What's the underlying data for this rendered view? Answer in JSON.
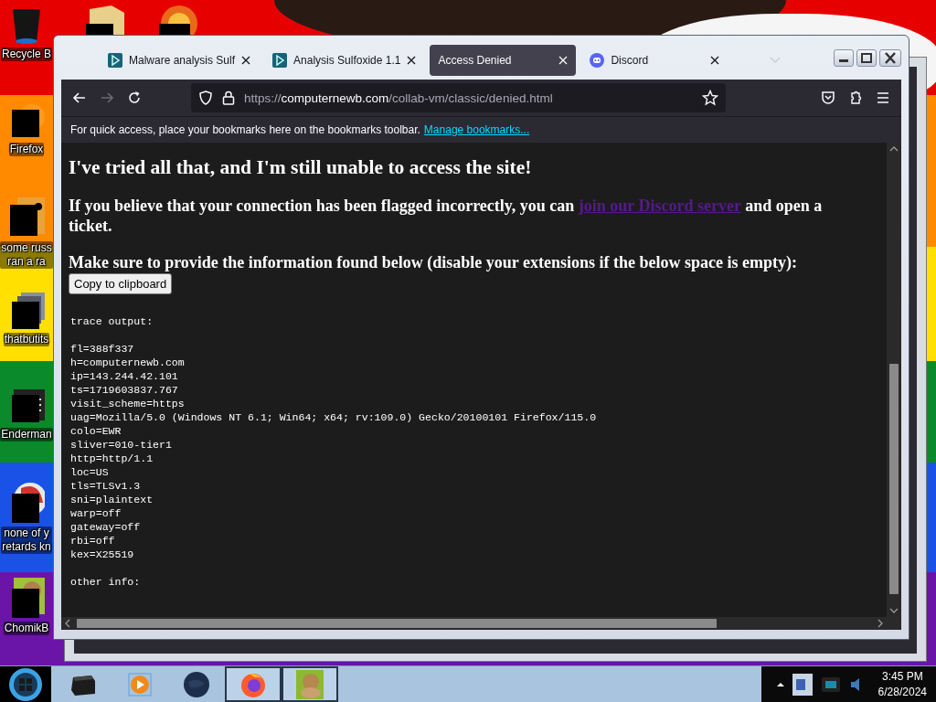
{
  "desktop": {
    "icons": [
      {
        "kind": "bin",
        "label_lines": [
          "Recycle B"
        ]
      },
      {
        "kind": "firefox",
        "label_lines": [
          "Firefox"
        ]
      },
      {
        "kind": "document",
        "label_lines": [
          "some russ",
          "ran a ra"
        ]
      },
      {
        "kind": "windows",
        "label_lines": [
          "thatbutits"
        ]
      },
      {
        "kind": "terminal",
        "label_lines": [
          "Enderman"
        ]
      },
      {
        "kind": "browser",
        "label_lines": [
          "none of y",
          "retards kn"
        ]
      },
      {
        "kind": "hamster",
        "label_lines": [
          "ChomikB"
        ]
      }
    ]
  },
  "browser": {
    "tabs": [
      {
        "title": "Malware analysis Sulf",
        "kind": "video",
        "selected": false
      },
      {
        "title": "Analysis Sulfoxide 1.1",
        "kind": "video",
        "selected": false
      },
      {
        "title": "Access Denied",
        "kind": "plain",
        "selected": true
      },
      {
        "title": "Discord",
        "kind": "chat",
        "selected": false
      }
    ],
    "nav": {
      "back_disabled": false,
      "forward_disabled": true
    },
    "url_parts": [
      {
        "text": "https://",
        "emphasis": false
      },
      {
        "text": "computernewb.com",
        "emphasis": true
      },
      {
        "text": "/collab-vm/classic/denied.html",
        "emphasis": false
      }
    ],
    "bookmarks_bar": {
      "text": "For quick access, place your bookmarks here on the bookmarks toolbar.",
      "link": "Manage bookmarks..."
    },
    "page": {
      "heading": "I've tried all that, and I'm still unable to access the site!",
      "paragraph": {
        "before": "If you believe that your connection has been flagged incorrectly, you can ",
        "link": "join our Discord server",
        "after": " and open a ticket."
      },
      "instruction": "Make sure to provide the information found below (disable your extensions if the below space is empty):",
      "copy_button": "Copy to clipboard",
      "trace_blocks": [
        [
          "trace output:"
        ],
        [
          "fl=388f337",
          "h=computernewb.com",
          "ip=143.244.42.101",
          "ts=1719603837.767",
          "visit_scheme=https",
          "uag=Mozilla/5.0 (Windows NT 6.1; Win64; x64; rv:109.0) Gecko/20100101 Firefox/115.0",
          "colo=EWR",
          "sliver=010-tier1",
          "http=http/1.1",
          "loc=US",
          "tls=TLSv1.3",
          "sni=plaintext",
          "warp=off",
          "gateway=off",
          "rbi=off",
          "kex=X25519"
        ],
        [
          "other info:"
        ]
      ]
    }
  },
  "taskbar": {
    "apps": [
      {
        "kind": "device",
        "running": false
      },
      {
        "kind": "player",
        "running": false
      },
      {
        "kind": "globe",
        "running": false
      },
      {
        "kind": "firefox",
        "running": true
      },
      {
        "kind": "hamster",
        "running": true
      }
    ],
    "clock": {
      "time": "3:45 PM",
      "date": "6/28/2024"
    }
  }
}
